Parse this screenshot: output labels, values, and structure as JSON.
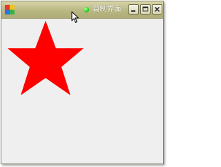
{
  "window": {
    "title": "自制界面",
    "icon": "app-logo-icon",
    "status_indicator": {
      "icon": "green-dot-icon",
      "color": "#2ecb22"
    },
    "controls": {
      "minimize": {
        "icon": "minimize-icon"
      },
      "maximize": {
        "icon": "maximize-icon"
      },
      "close": {
        "icon": "close-icon"
      }
    }
  },
  "canvas": {
    "background": "#efefef",
    "shape": {
      "type": "five-pointed-star",
      "color": "#ff0000"
    }
  },
  "pointer": {
    "icon": "mouse-cursor-icon"
  }
}
